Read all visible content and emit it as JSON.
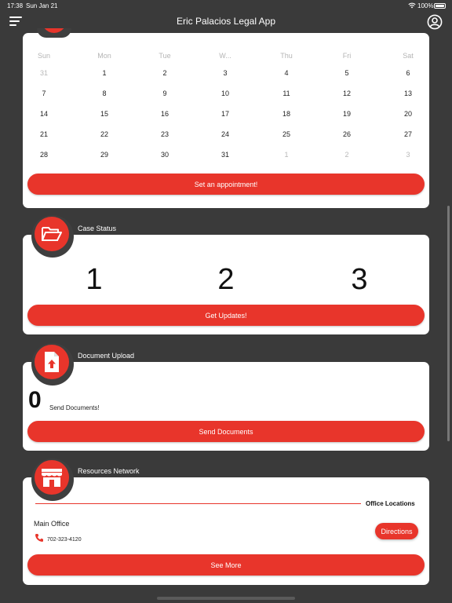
{
  "status_bar": {
    "time": "17:38",
    "date": "Sun Jan 21",
    "battery": "100%"
  },
  "navbar": {
    "title": "Eric Palacios Legal App",
    "menu_icon": "menu-icon",
    "profile_icon": "profile-icon"
  },
  "calendar": {
    "weekdays": [
      "Sun",
      "Mon",
      "Tue",
      "W...",
      "Thu",
      "Fri",
      "Sat"
    ],
    "weeks": [
      [
        {
          "d": "31",
          "dim": true
        },
        {
          "d": "1"
        },
        {
          "d": "2"
        },
        {
          "d": "3"
        },
        {
          "d": "4"
        },
        {
          "d": "5"
        },
        {
          "d": "6"
        }
      ],
      [
        {
          "d": "7"
        },
        {
          "d": "8"
        },
        {
          "d": "9"
        },
        {
          "d": "10"
        },
        {
          "d": "11"
        },
        {
          "d": "12"
        },
        {
          "d": "13"
        }
      ],
      [
        {
          "d": "14"
        },
        {
          "d": "15"
        },
        {
          "d": "16"
        },
        {
          "d": "17"
        },
        {
          "d": "18"
        },
        {
          "d": "19"
        },
        {
          "d": "20"
        }
      ],
      [
        {
          "d": "21"
        },
        {
          "d": "22"
        },
        {
          "d": "23"
        },
        {
          "d": "24"
        },
        {
          "d": "25"
        },
        {
          "d": "26"
        },
        {
          "d": "27"
        }
      ],
      [
        {
          "d": "28"
        },
        {
          "d": "29"
        },
        {
          "d": "30"
        },
        {
          "d": "31"
        },
        {
          "d": "1",
          "dim": true
        },
        {
          "d": "2",
          "dim": true
        },
        {
          "d": "3",
          "dim": true
        }
      ]
    ],
    "button_label": "Set an appointment!"
  },
  "case_status": {
    "title": "Case Status",
    "icon": "folder-open-icon",
    "steps": [
      "1",
      "2",
      "3"
    ],
    "button_label": "Get Updates!"
  },
  "document_upload": {
    "title": "Document Upload",
    "icon": "file-upload-icon",
    "count": "0",
    "count_label": "Send Documents!",
    "button_label": "Send Documents"
  },
  "resources": {
    "title": "Resources Network",
    "icon": "storefront-icon",
    "office_locations_label": "Office Locations",
    "office_name": "Main Office",
    "phone": "702-323-4120",
    "directions_label": "Directions",
    "button_label": "See More"
  },
  "colors": {
    "accent": "#e8352b",
    "background": "#3a3a3a",
    "card": "#ffffff"
  }
}
